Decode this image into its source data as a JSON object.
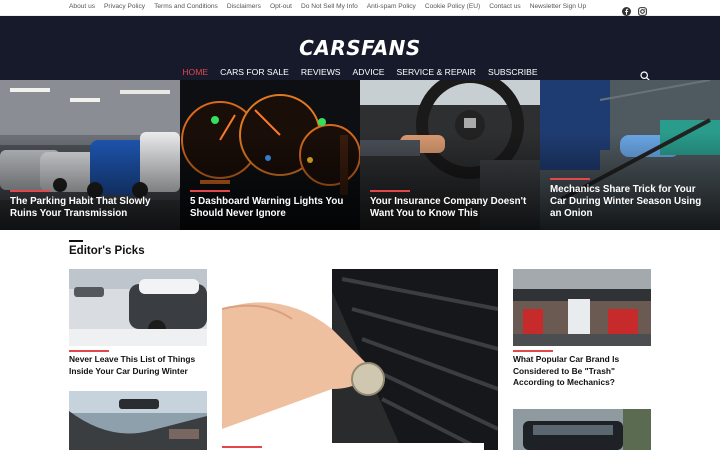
{
  "topbar": {
    "links": [
      "About us",
      "Privacy Policy",
      "Terms and Conditions",
      "Disclaimers",
      "Opt-out",
      "Do Not Sell My Info",
      "Anti-spam Policy",
      "Cookie Policy (EU)",
      "Contact us",
      "Newsletter Sign Up"
    ],
    "social_icons": [
      "facebook-icon",
      "instagram-icon"
    ]
  },
  "header": {
    "logo": "CARSFANS",
    "nav": [
      "HOME",
      "CARS FOR SALE",
      "REVIEWS",
      "ADVICE",
      "SERVICE & REPAIR",
      "SUBSCRIBE"
    ],
    "active_nav": "HOME",
    "search_icon": "search-icon"
  },
  "hero": [
    {
      "title": "The Parking Habit That Slowly Ruins Your Transmission"
    },
    {
      "title": "5 Dashboard Warning Lights You Should Never Ignore"
    },
    {
      "title": "Your Insurance Company Doesn't Want You to Know This"
    },
    {
      "title": "Mechanics Share Trick for Your Car During Winter Season Using an Onion"
    }
  ],
  "editors_picks": {
    "heading": "Editor's Picks",
    "left": [
      {
        "title": "Never Leave This List of Things Inside Your Car During Winter"
      }
    ],
    "right": [
      {
        "title": "What Popular Car Brand Is Considered to Be \"Trash\" According to Mechanics?"
      }
    ]
  },
  "colors": {
    "accent": "#e2474b",
    "header_bg": "#161a2b"
  }
}
